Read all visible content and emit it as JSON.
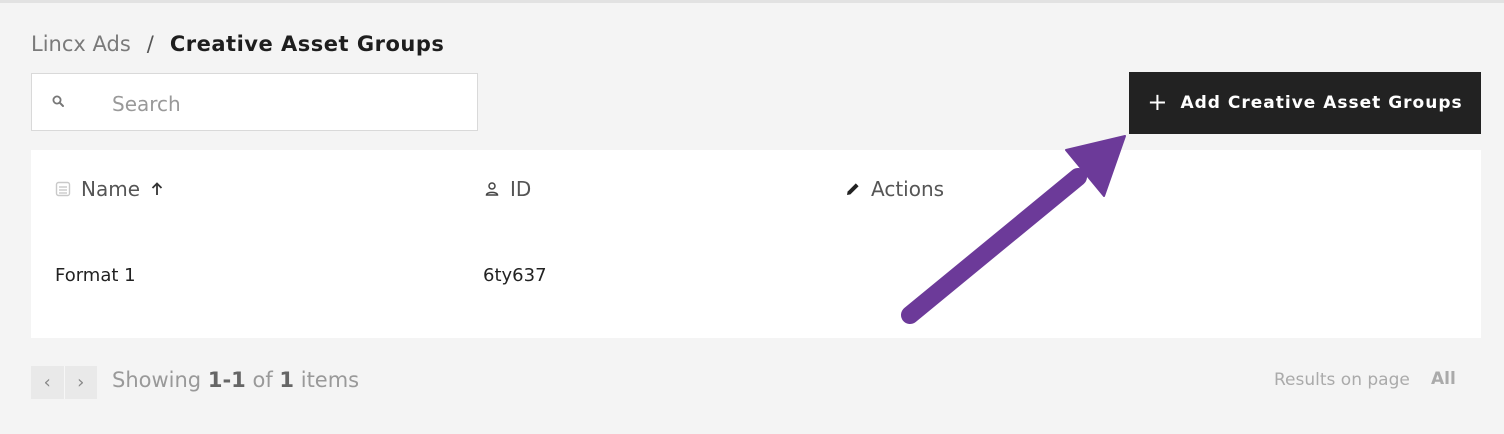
{
  "breadcrumb": {
    "parent": "Lincx Ads",
    "separator": "/",
    "current": "Creative Asset Groups"
  },
  "search": {
    "placeholder": "Search",
    "value": "",
    "icon": "search-icon"
  },
  "toolbar": {
    "add_icon": "+",
    "add_label": "Add Creative Asset Groups"
  },
  "table": {
    "columns": [
      {
        "label": "Name",
        "icon": "table-icon",
        "sort": "ascending"
      },
      {
        "label": "ID",
        "icon": "user-icon"
      },
      {
        "label": "Actions",
        "icon": "pencil-icon"
      }
    ],
    "rows": [
      {
        "name": "Format 1",
        "id": "6ty637"
      }
    ]
  },
  "pagination": {
    "prev": "‹",
    "next": "›",
    "showing_prefix": "Showing",
    "range_start": "1",
    "range_sep": "-",
    "range_end": "1",
    "of_word": "of",
    "total": "1",
    "items_word": "items",
    "results_label": "Results on page",
    "results_value": "All"
  },
  "colors": {
    "button_bg": "#222222",
    "annotation_arrow": "#6c3a99",
    "page_bg": "#f4f4f4"
  }
}
